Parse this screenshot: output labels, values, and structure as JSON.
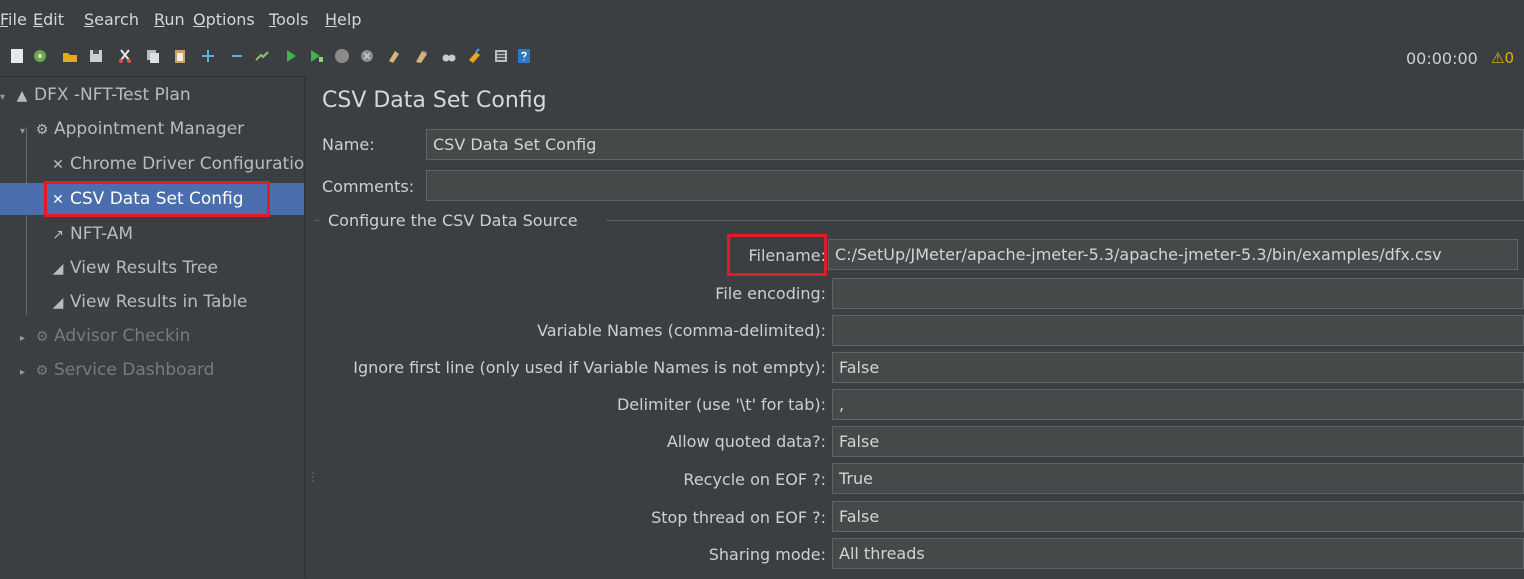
{
  "menu": [
    "File",
    "Edit",
    "Search",
    "Run",
    "Options",
    "Tools",
    "Help"
  ],
  "toolbar": {
    "icons": [
      "new-icon",
      "templates-icon",
      "open-icon",
      "save-icon",
      "cut-icon",
      "copy-icon",
      "paste-icon",
      "expand-icon",
      "collapse-icon",
      "toggle-icon",
      "start-icon",
      "start-no-pauses-icon",
      "stop-icon",
      "shutdown-icon",
      "clear-icon",
      "clear-all-icon",
      "search-icon",
      "reset-search-icon",
      "function-helper-icon",
      "help-icon"
    ],
    "timer": "00:00:00",
    "warning": "0"
  },
  "tree": {
    "root": "DFX -NFT-Test Plan",
    "group": "Appointment Manager",
    "items": [
      "Chrome Driver Configuratio",
      "CSV Data Set Config",
      "NFT-AM",
      "View Results Tree",
      "View Results in Table"
    ],
    "other_groups": [
      "Advisor Checkin",
      "Service Dashboard"
    ]
  },
  "panel": {
    "title": "CSV Data Set Config",
    "name_label": "Name:",
    "name_value": "CSV Data Set Config",
    "comments_label": "Comments:",
    "comments_value": "",
    "section": "Configure the CSV Data Source",
    "fields": [
      {
        "label": "Filename:",
        "value": "C:/SetUp/JMeter/apache-jmeter-5.3/apache-jmeter-5.3/bin/examples/dfx.csv"
      },
      {
        "label": "File encoding:",
        "value": ""
      },
      {
        "label": "Variable Names (comma-delimited):",
        "value": ""
      },
      {
        "label": "Ignore first line (only used if Variable Names is not empty):",
        "value": "False"
      },
      {
        "label": "Delimiter (use '\\t' for tab):",
        "value": ","
      },
      {
        "label": "Allow quoted data?:",
        "value": "False"
      },
      {
        "label": "Recycle on EOF ?:",
        "value": "True"
      },
      {
        "label": "Stop thread on EOF ?:",
        "value": "False"
      },
      {
        "label": "Sharing mode:",
        "value": "All threads"
      }
    ]
  },
  "colors": {
    "background": "#3c3f41",
    "selection": "#4b6eaf",
    "highlight": "#e21b24"
  }
}
